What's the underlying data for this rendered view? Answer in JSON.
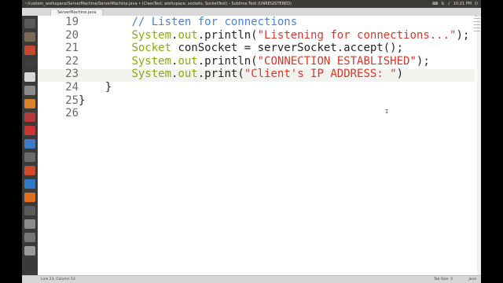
{
  "window": {
    "title": "~/custom_workspace/ServerMachine/ServerMachine.java • (ClassTest, workspace, sockets, SocketTest) - Sublime Text (UNREGISTERED)",
    "clock": "10:21 PM"
  },
  "tab": {
    "label": "ServerMachine.java"
  },
  "editor": {
    "lines": [
      {
        "num": "19",
        "indent": "        ",
        "tokens": [
          {
            "t": "// Listen for connections",
            "c": "cm"
          }
        ]
      },
      {
        "num": "20",
        "indent": "        ",
        "tokens": [
          {
            "t": "System",
            "c": "cls"
          },
          {
            "t": ".",
            "c": "pun"
          },
          {
            "t": "out",
            "c": "cls"
          },
          {
            "t": ".println(",
            "c": "pun"
          },
          {
            "t": "\"Listening for connections...\"",
            "c": "str"
          },
          {
            "t": ");",
            "c": "pun"
          }
        ]
      },
      {
        "num": "21",
        "indent": "        ",
        "tokens": [
          {
            "t": "Socket",
            "c": "cls"
          },
          {
            "t": " conSocket = serverSocket.accept();",
            "c": "pun"
          }
        ]
      },
      {
        "num": "22",
        "indent": "        ",
        "tokens": [
          {
            "t": "System",
            "c": "cls"
          },
          {
            "t": ".",
            "c": "pun"
          },
          {
            "t": "out",
            "c": "cls"
          },
          {
            "t": ".println(",
            "c": "pun"
          },
          {
            "t": "\"CONNECTION ESTABLISHED\"",
            "c": "str"
          },
          {
            "t": ");",
            "c": "pun"
          }
        ]
      },
      {
        "num": "23",
        "indent": "        ",
        "tokens": [
          {
            "t": "System",
            "c": "cls"
          },
          {
            "t": ".",
            "c": "pun"
          },
          {
            "t": "out",
            "c": "cls"
          },
          {
            "t": ".print(",
            "c": "pun"
          },
          {
            "t": "\"Client's IP ADDRESS: \"",
            "c": "str"
          },
          {
            "t": ")",
            "c": "pun"
          }
        ]
      },
      {
        "num": "24",
        "indent": "    ",
        "tokens": [
          {
            "t": "}",
            "c": "pun"
          }
        ]
      },
      {
        "num": "25",
        "indent": "",
        "tokens": [
          {
            "t": "}",
            "c": "pun"
          }
        ]
      },
      {
        "num": "26",
        "indent": "",
        "tokens": []
      }
    ],
    "current_line_number": "23"
  },
  "status": {
    "position": "Line 23, Column 53",
    "tab_size": "Tab Size: 4",
    "syntax": "Java"
  },
  "colors": {
    "comment": "#4a83d2",
    "class": "#8da812",
    "string": "#d9362b",
    "launcher": "#3a3a38"
  },
  "launcher_icons": [
    "dash-icon",
    "files-icon",
    "browser-icon",
    "terminal-icon",
    "text-editor-icon",
    "settings-icon",
    "software-center-icon",
    "music-icon",
    "video-icon",
    "chat-icon",
    "mail-icon",
    "photos-icon",
    "store-icon",
    "sublime-icon",
    "workspace-icon",
    "updates-icon",
    "disk-icon",
    "trash-icon"
  ]
}
